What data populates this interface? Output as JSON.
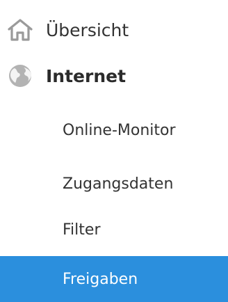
{
  "nav": {
    "items": [
      {
        "label": "Übersicht",
        "icon": "home-icon"
      },
      {
        "label": "Internet",
        "icon": "globe-icon"
      }
    ],
    "subitems": [
      {
        "label": "Online-Monitor"
      },
      {
        "label": "Zugangsdaten"
      },
      {
        "label": "Filter"
      },
      {
        "label": "Freigaben"
      }
    ]
  },
  "colors": {
    "selected_bg": "#2b8fdd",
    "text": "#333333",
    "icon": "#9a9a9a"
  }
}
